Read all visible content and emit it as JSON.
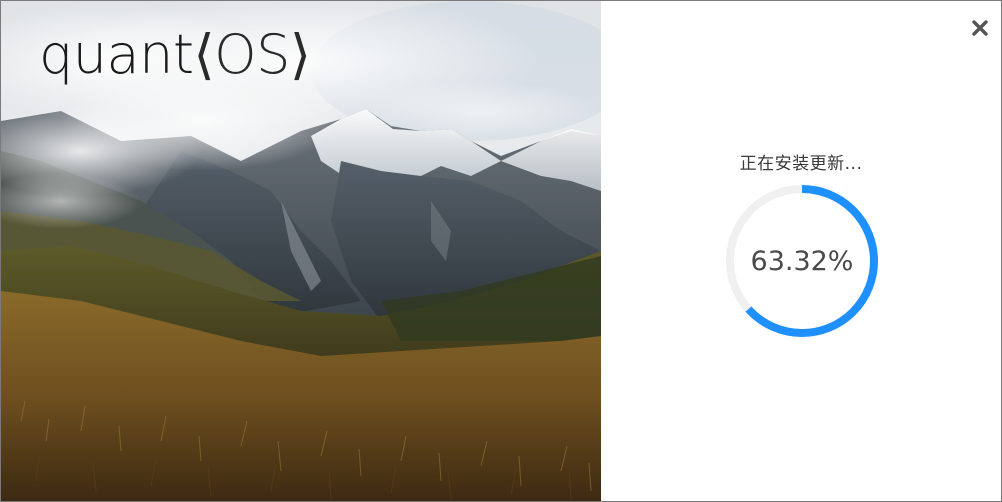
{
  "window": {
    "close_icon": "close-icon"
  },
  "hero": {
    "logo_text_main": "quant",
    "logo_text_brand": "⟨OS⟩"
  },
  "installer": {
    "status_text": "正在安装更新...",
    "progress_percent": 63.32,
    "progress_label": "63.32%"
  },
  "colors": {
    "accent": "#1e90ff",
    "track": "#f0f0f0",
    "text": "#4a4a4a"
  }
}
